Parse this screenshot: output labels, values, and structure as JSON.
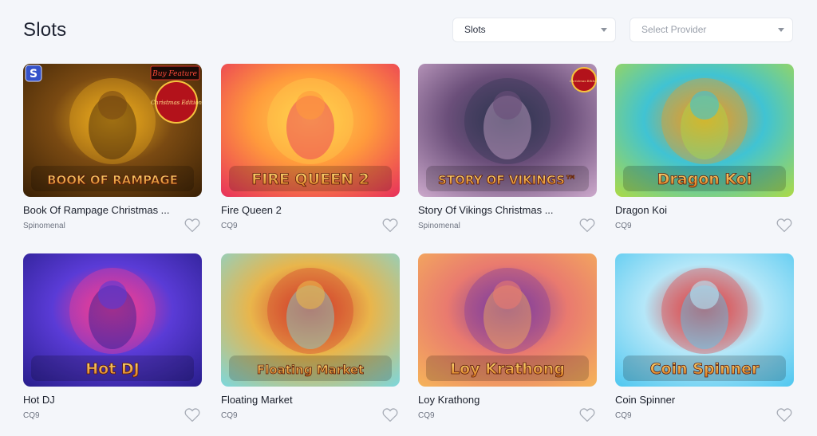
{
  "header": {
    "title": "Slots",
    "category_select": {
      "value": "Slots"
    },
    "provider_select": {
      "placeholder": "Select Provider"
    }
  },
  "games": [
    {
      "name": "Book Of Rampage Christmas ...",
      "provider": "Spinomenal",
      "logo": "BOOK OF RAMPAGE",
      "badge": "Buy Feature",
      "ribbon": "Christmas Edition",
      "corner_mark": "S",
      "colors": [
        "#3c2206",
        "#7a4a12",
        "#f2b01e"
      ]
    },
    {
      "name": "Fire Queen 2",
      "provider": "CQ9",
      "logo": "FIRE QUEEN 2",
      "colors": [
        "#e8345a",
        "#ff9a3c",
        "#ffd34d"
      ]
    },
    {
      "name": "Story Of Vikings Christmas ...",
      "provider": "Spinomenal",
      "logo": "STORY OF VIKINGS™",
      "ribbon": "Christmas Edition",
      "colors": [
        "#c9a6c9",
        "#6b4f7a",
        "#2e3550"
      ]
    },
    {
      "name": "Dragon Koi",
      "provider": "CQ9",
      "logo": "Dragon Koi",
      "colors": [
        "#a9d94a",
        "#40c3d3",
        "#f39a1b"
      ]
    },
    {
      "name": "Hot DJ",
      "provider": "CQ9",
      "logo": "Hot DJ",
      "colors": [
        "#2a1f8f",
        "#5a3bd6",
        "#ff3c8e"
      ]
    },
    {
      "name": "Floating Market",
      "provider": "CQ9",
      "logo": "Floating Market",
      "colors": [
        "#7fd6d8",
        "#e9b54b",
        "#d23a2a"
      ]
    },
    {
      "name": "Loy Krathong",
      "provider": "CQ9",
      "logo": "Loy Krathong",
      "colors": [
        "#f5b25a",
        "#e97a6f",
        "#7a3aa0"
      ]
    },
    {
      "name": "Coin Spinner",
      "provider": "CQ9",
      "logo": "Coin Spinner",
      "colors": [
        "#52c8f0",
        "#b5e7f8",
        "#e33a3a"
      ]
    }
  ]
}
